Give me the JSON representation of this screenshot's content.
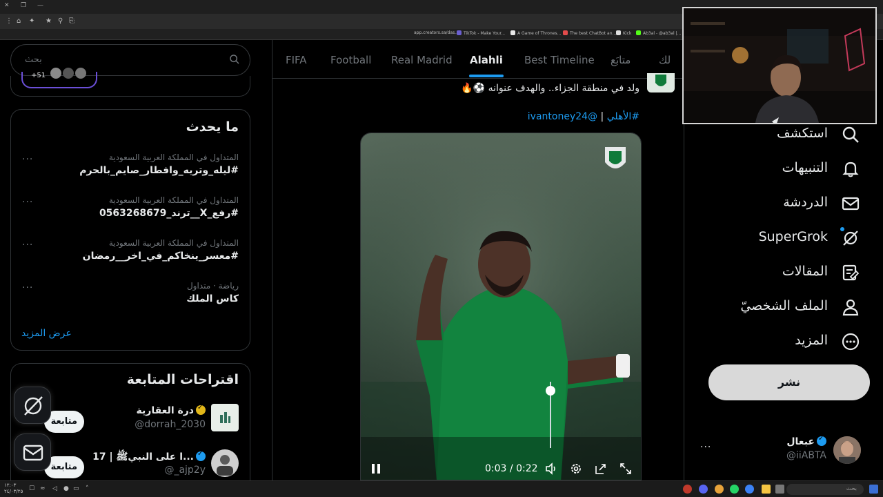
{
  "browser": {
    "bookmarks": [
      {
        "label": "app.creators.sa/das...",
        "color": "#2a2a2a"
      },
      {
        "label": "TikTok - Make Your...",
        "color": "#555555"
      },
      {
        "label": "A Game of Thrones...",
        "color": "#e8e8e8"
      },
      {
        "label": "The best ChatBot an...",
        "color": "#e24b4b"
      },
      {
        "label": "Kick",
        "color": "#dddddd"
      },
      {
        "label": "Ab3al - @ab3al |...",
        "color": "#53fc18"
      }
    ]
  },
  "sidebar_left": {
    "search_placeholder": "بحث",
    "badge_count": "+51",
    "trends_title": "ما يحدث",
    "trends": [
      {
        "context": "المتداول في المملكة العربية السعودية",
        "name": "#ليله_وتريه_وافطار_صايم_بالحرم",
        "more": "···"
      },
      {
        "context": "المتداول في المملكة العربية السعودية",
        "name": "#رفع_X__ترند_0563268679",
        "more": "···"
      },
      {
        "context": "المتداول في المملكة العربية السعودية",
        "name": "#معسر_ينخاكم_في_اخر__رمضان",
        "more": "···"
      },
      {
        "context": "رياضة · متداول",
        "name": "كاس الملك",
        "more": "···"
      }
    ],
    "show_more": "عرض المزيد",
    "follow_title": "اقتراحات المتابعة",
    "follow_suggestions": [
      {
        "name": "درة العقارية",
        "handle": "@dorrah_2030",
        "button": "متابعة",
        "avatar_color": "#e8efe9",
        "verified_color": "#e2b719"
      },
      {
        "name": "...ا على النبيﷺ | 17",
        "handle": "@_ajp2y",
        "button": "متابعة",
        "avatar_color": "#cfcfcf",
        "verified_color": "#1d9bf0"
      }
    ]
  },
  "timeline": {
    "tabs": [
      {
        "label": "FIFA",
        "active": false
      },
      {
        "label": "Football",
        "active": false
      },
      {
        "label": "Real Madrid",
        "active": false
      },
      {
        "label": "Alahli",
        "active": true
      },
      {
        "label": "Best Timeline",
        "active": false
      },
      {
        "label": "متابَع",
        "active": false
      },
      {
        "label": "لك",
        "active": false
      }
    ],
    "tweet": {
      "text": "ولد في منطقة الجزاء.. والهدف عنوانه ⚽️🔥",
      "hashtag": "#الأهلي",
      "separator": "|",
      "mention": "@ivantoney24"
    },
    "video": {
      "current_time": "0:03",
      "separator": "/",
      "duration": "0:22",
      "volume_level": 0.92
    }
  },
  "sidebar_right": {
    "nav": [
      {
        "label": "استكشف",
        "icon": "search-icon"
      },
      {
        "label": "التنبيهات",
        "icon": "bell-icon"
      },
      {
        "label": "الدردشة",
        "icon": "mail-icon"
      },
      {
        "label": "SuperGrok",
        "icon": "grok-icon"
      },
      {
        "label": "المقالات",
        "icon": "article-icon"
      },
      {
        "label": "الملف الشخصيّ",
        "icon": "profile-icon"
      },
      {
        "label": "المزيد",
        "icon": "more-circle-icon"
      }
    ],
    "post_button": "نشر",
    "account": {
      "name": "عبعال",
      "handle": "@iiABTA",
      "more": "···"
    }
  },
  "taskbar": {
    "search_placeholder": "بحث",
    "clock_time": "١٢:٠٣",
    "clock_date": "٢٤/٠٣/٢٥"
  },
  "colors": {
    "accent": "#1d9bf0",
    "border": "#2f3336",
    "muted": "#71767b",
    "club_green": "#0f7a3a"
  }
}
